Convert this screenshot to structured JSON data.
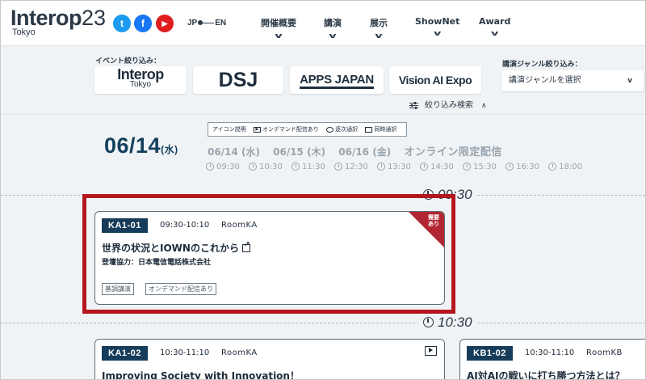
{
  "brand": {
    "name": "Interop",
    "number": "23",
    "sub": "Tokyo"
  },
  "social": [
    {
      "name": "twitter-icon",
      "glyph": "t"
    },
    {
      "name": "facebook-icon",
      "glyph": "f"
    },
    {
      "name": "youtube-icon",
      "glyph": "▶"
    }
  ],
  "lang": {
    "jp": "JP",
    "en": "EN"
  },
  "nav": [
    {
      "label": "開催概要"
    },
    {
      "label": "講演"
    },
    {
      "label": "展示"
    },
    {
      "label": "ShowNet"
    },
    {
      "label": "Award"
    }
  ],
  "filter": {
    "event_label": "イベント絞り込み：",
    "events": [
      {
        "line1": "Interop",
        "line2": "Tokyo"
      },
      {
        "line1": "DSJ"
      },
      {
        "line1": "APPS JAPAN"
      },
      {
        "line1": "Vision AI Expo"
      }
    ],
    "genre_label": "講演ジャンル絞り込み：",
    "genre_placeholder": "講演ジャンルを選択",
    "genre_arrow": "v",
    "advanced": "絞り込み検索",
    "advanced_arrow": "∧"
  },
  "schedule": {
    "date": "06/14",
    "weekday": "(水)",
    "legend": {
      "title": "アイコン説明",
      "items": [
        "オンデマンド配信あり",
        "逐次通訳",
        "同時通訳"
      ]
    },
    "date_tabs": [
      "06/14 (水)",
      "06/15 (木)",
      "06/16 (金)",
      "オンライン限定配信"
    ],
    "times": [
      "09:30",
      "10:30",
      "11:30",
      "12:30",
      "13:30",
      "14:30",
      "15:30",
      "16:30",
      "18:00"
    ],
    "slots": [
      "09:30",
      "10:30"
    ]
  },
  "sessions": [
    {
      "code": "KA1-01",
      "time": "09:30-10:10",
      "room": "RoomKA",
      "title": "世界の状況とIOWNのこれから",
      "sponsor": "登壇協力：日本電信電話株式会社",
      "tags": [
        "基調講演",
        "オンデマンド配信あり"
      ],
      "corner": "需要あり"
    },
    {
      "code": "KA1-02",
      "time": "10:30-11:10",
      "room": "RoomKA",
      "title": "Improving Society with Innovation！"
    },
    {
      "code": "KB1-02",
      "time": "10:30-11:10",
      "room": "RoomKB",
      "title": "AI対AIの戦いに打ち勝つ方法とは？"
    }
  ],
  "colors": {
    "accent": "#153c5a",
    "highlight": "#b5151f",
    "muted": "#98a4ae"
  }
}
